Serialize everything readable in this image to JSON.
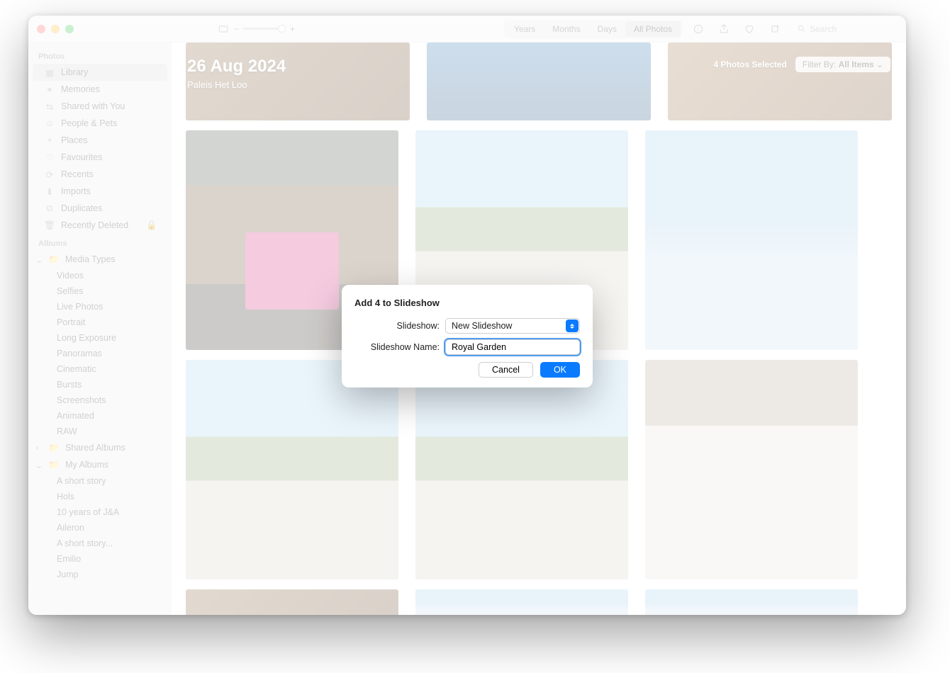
{
  "toolbar": {
    "segments": [
      "Years",
      "Months",
      "Days",
      "All Photos"
    ],
    "active_segment": 3,
    "search_placeholder": "Search"
  },
  "header": {
    "date": "26 Aug 2024",
    "location": "Paleis Het Loo",
    "selection_count": "4 Photos Selected",
    "filter_prefix": "Filter By:",
    "filter_value": "All Items"
  },
  "sidebar": {
    "section_photos": "Photos",
    "photos_items": [
      {
        "label": "Library",
        "icon": "photo-stack-icon",
        "selected": true
      },
      {
        "label": "Memories",
        "icon": "memories-icon"
      },
      {
        "label": "Shared with You",
        "icon": "shared-icon"
      },
      {
        "label": "People & Pets",
        "icon": "people-icon"
      },
      {
        "label": "Places",
        "icon": "pin-icon"
      },
      {
        "label": "Favourites",
        "icon": "heart-icon"
      },
      {
        "label": "Recents",
        "icon": "clock-icon"
      },
      {
        "label": "Imports",
        "icon": "import-icon"
      },
      {
        "label": "Duplicates",
        "icon": "duplicates-icon"
      },
      {
        "label": "Recently Deleted",
        "icon": "trash-icon",
        "locked": true
      }
    ],
    "section_albums": "Albums",
    "media_types_label": "Media Types",
    "media_types": [
      "Videos",
      "Selfies",
      "Live Photos",
      "Portrait",
      "Long Exposure",
      "Panoramas",
      "Cinematic",
      "Bursts",
      "Screenshots",
      "Animated",
      "RAW"
    ],
    "shared_albums_label": "Shared Albums",
    "my_albums_label": "My Albums",
    "my_albums": [
      "A short story",
      "Hols",
      "10 years of J&A",
      "Aileron",
      "A short story...",
      "Emilio",
      "Jump"
    ]
  },
  "dialog": {
    "title": "Add 4 to Slideshow",
    "slideshow_label": "Slideshow:",
    "slideshow_value": "New Slideshow",
    "name_label": "Slideshow Name:",
    "name_value": "Royal Garden",
    "cancel": "Cancel",
    "ok": "OK"
  }
}
